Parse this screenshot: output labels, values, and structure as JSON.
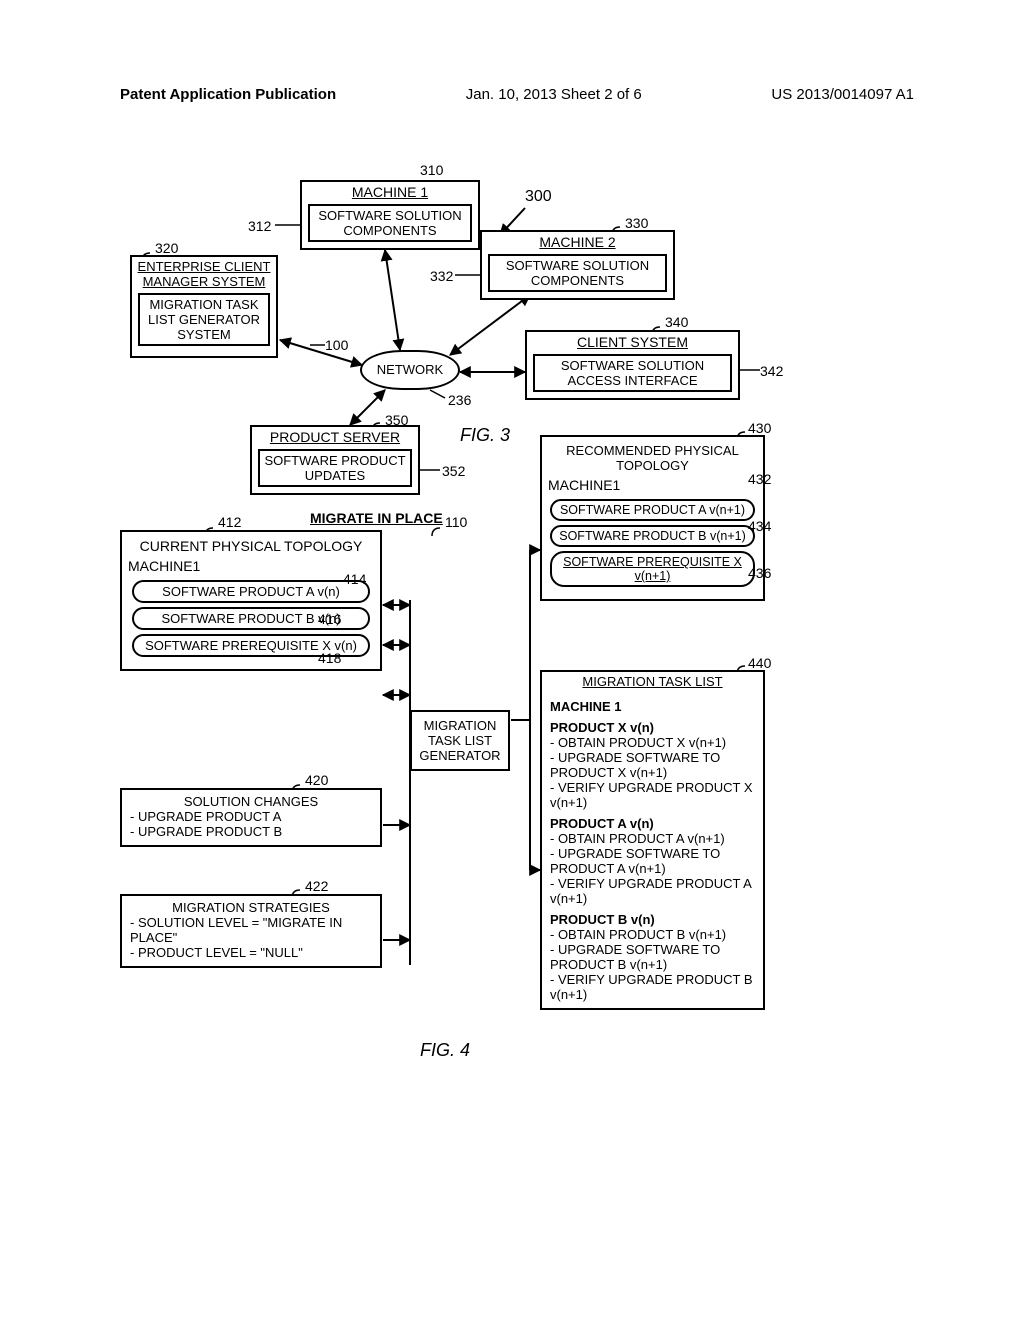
{
  "header": {
    "left": "Patent Application Publication",
    "center": "Jan. 10, 2013  Sheet 2 of 6",
    "right": "US 2013/0014097 A1"
  },
  "fig3": {
    "label": "FIG. 3",
    "overall_ref": "300",
    "network_label": "NETWORK",
    "network_ref": "236",
    "machine1": {
      "ref": "310",
      "title": "MACHINE 1",
      "inner": "SOFTWARE SOLUTION COMPONENTS",
      "inner_ref": "312"
    },
    "enterprise": {
      "ref": "320",
      "title": "ENTERPRISE CLIENT MANAGER SYSTEM",
      "inner": "MIGRATION TASK LIST GENERATOR SYSTEM",
      "inner_ref": "100"
    },
    "machine2": {
      "ref": "330",
      "title": "MACHINE 2",
      "inner": "SOFTWARE SOLUTION COMPONENTS",
      "inner_ref": "332"
    },
    "client": {
      "ref": "340",
      "title": "CLIENT SYSTEM",
      "inner": "SOFTWARE SOLUTION ACCESS INTERFACE",
      "inner_ref": "342"
    },
    "product_server": {
      "ref": "350",
      "title": "PRODUCT SERVER",
      "inner": "SOFTWARE PRODUCT UPDATES",
      "inner_ref": "352"
    }
  },
  "fig4": {
    "label": "FIG. 4",
    "title": "MIGRATE IN PLACE",
    "mtlg_ref": "110",
    "mtlg": "MIGRATION TASK LIST GENERATOR",
    "current": {
      "ref": "412",
      "title": "CURRENT PHYSICAL TOPOLOGY",
      "machine": "MACHINE1",
      "p1": "SOFTWARE PRODUCT A v(n)",
      "p1_ref": "414",
      "p2": "SOFTWARE PRODUCT B v(n)",
      "p2_ref": "416",
      "p3": "SOFTWARE PREREQUISITE X v(n)",
      "p3_ref": "418"
    },
    "solution_changes": {
      "ref": "420",
      "title": "SOLUTION CHANGES",
      "l1": "- UPGRADE PRODUCT A",
      "l2": "- UPGRADE PRODUCT B"
    },
    "strategies": {
      "ref": "422",
      "title": "MIGRATION STRATEGIES",
      "l1": "- SOLUTION LEVEL = \"MIGRATE IN PLACE\"",
      "l2": "- PRODUCT LEVEL = \"NULL\""
    },
    "recommended": {
      "ref": "430",
      "title": "RECOMMENDED PHYSICAL TOPOLOGY",
      "machine": "MACHINE1",
      "p1": "SOFTWARE PRODUCT A v(n+1)",
      "p1_ref": "432",
      "p2": "SOFTWARE PRODUCT B v(n+1)",
      "p2_ref": "434",
      "p3": "SOFTWARE PREREQUISITE X v(n+1)",
      "p3_ref": "436"
    },
    "migration_task_list": {
      "ref": "440",
      "title": "MIGRATION TASK LIST",
      "m": "MACHINE 1",
      "px_h": "PRODUCT X v(n)",
      "px_1": "- OBTAIN PRODUCT X v(n+1)",
      "px_2": "- UPGRADE SOFTWARE TO PRODUCT X v(n+1)",
      "px_3": "- VERIFY UPGRADE PRODUCT  X v(n+1)",
      "pa_h": "PRODUCT A v(n)",
      "pa_1": "- OBTAIN PRODUCT A v(n+1)",
      "pa_2": "- UPGRADE SOFTWARE TO PRODUCT A v(n+1)",
      "pa_3": "- VERIFY UPGRADE PRODUCT A v(n+1)",
      "pb_h": "PRODUCT B v(n)",
      "pb_1": "- OBTAIN PRODUCT B v(n+1)",
      "pb_2": "- UPGRADE SOFTWARE TO PRODUCT B v(n+1)",
      "pb_3": "- VERIFY UPGRADE PRODUCT B v(n+1)"
    }
  },
  "chart_data": {
    "type": "diagram",
    "figures": [
      {
        "id": "FIG. 3",
        "nodes": [
          {
            "ref": 310,
            "label": "MACHINE 1",
            "children": [
              {
                "ref": 312,
                "label": "SOFTWARE SOLUTION COMPONENTS"
              }
            ]
          },
          {
            "ref": 320,
            "label": "ENTERPRISE CLIENT MANAGER SYSTEM",
            "children": [
              {
                "ref": 100,
                "label": "MIGRATION TASK LIST GENERATOR SYSTEM"
              }
            ]
          },
          {
            "ref": 330,
            "label": "MACHINE 2",
            "children": [
              {
                "ref": 332,
                "label": "SOFTWARE SOLUTION COMPONENTS"
              }
            ]
          },
          {
            "ref": 340,
            "label": "CLIENT SYSTEM",
            "children": [
              {
                "ref": 342,
                "label": "SOFTWARE SOLUTION ACCESS INTERFACE"
              }
            ]
          },
          {
            "ref": 350,
            "label": "PRODUCT SERVER",
            "children": [
              {
                "ref": 352,
                "label": "SOFTWARE PRODUCT UPDATES"
              }
            ]
          },
          {
            "ref": 236,
            "label": "NETWORK"
          }
        ],
        "edges": [
          {
            "from": 236,
            "to": 310,
            "bidir": true
          },
          {
            "from": 236,
            "to": 320,
            "bidir": true
          },
          {
            "from": 236,
            "to": 330,
            "bidir": true
          },
          {
            "from": 236,
            "to": 340,
            "bidir": true
          },
          {
            "from": 236,
            "to": 350,
            "bidir": true
          }
        ],
        "overall_ref": 300
      },
      {
        "id": "FIG. 4",
        "title": "MIGRATE IN PLACE",
        "central": {
          "ref": 110,
          "label": "MIGRATION TASK LIST GENERATOR"
        },
        "inputs": [
          {
            "ref": 412,
            "label": "CURRENT PHYSICAL TOPOLOGY",
            "items": [
              {
                "ref": 414,
                "label": "SOFTWARE PRODUCT A v(n)"
              },
              {
                "ref": 416,
                "label": "SOFTWARE PRODUCT B v(n)"
              },
              {
                "ref": 418,
                "label": "SOFTWARE PREREQUISITE X v(n)"
              }
            ]
          },
          {
            "ref": 420,
            "label": "SOLUTION CHANGES",
            "items": [
              "UPGRADE PRODUCT A",
              "UPGRADE PRODUCT B"
            ]
          },
          {
            "ref": 422,
            "label": "MIGRATION STRATEGIES",
            "items": [
              "SOLUTION LEVEL = MIGRATE IN PLACE",
              "PRODUCT LEVEL = NULL"
            ]
          }
        ],
        "outputs": [
          {
            "ref": 430,
            "label": "RECOMMENDED PHYSICAL TOPOLOGY",
            "items": [
              {
                "ref": 432,
                "label": "SOFTWARE PRODUCT A v(n+1)"
              },
              {
                "ref": 434,
                "label": "SOFTWARE PRODUCT B v(n+1)"
              },
              {
                "ref": 436,
                "label": "SOFTWARE PREREQUISITE X v(n+1)"
              }
            ]
          },
          {
            "ref": 440,
            "label": "MIGRATION TASK LIST",
            "machine": "MACHINE 1",
            "products": [
              {
                "name": "PRODUCT X v(n)",
                "steps": [
                  "OBTAIN PRODUCT X v(n+1)",
                  "UPGRADE SOFTWARE TO PRODUCT X v(n+1)",
                  "VERIFY UPGRADE PRODUCT X v(n+1)"
                ]
              },
              {
                "name": "PRODUCT A v(n)",
                "steps": [
                  "OBTAIN PRODUCT A v(n+1)",
                  "UPGRADE SOFTWARE TO PRODUCT A v(n+1)",
                  "VERIFY UPGRADE PRODUCT A v(n+1)"
                ]
              },
              {
                "name": "PRODUCT B v(n)",
                "steps": [
                  "OBTAIN PRODUCT B v(n+1)",
                  "UPGRADE SOFTWARE TO PRODUCT B v(n+1)",
                  "VERIFY UPGRADE PRODUCT B v(n+1)"
                ]
              }
            ]
          }
        ]
      }
    ]
  }
}
